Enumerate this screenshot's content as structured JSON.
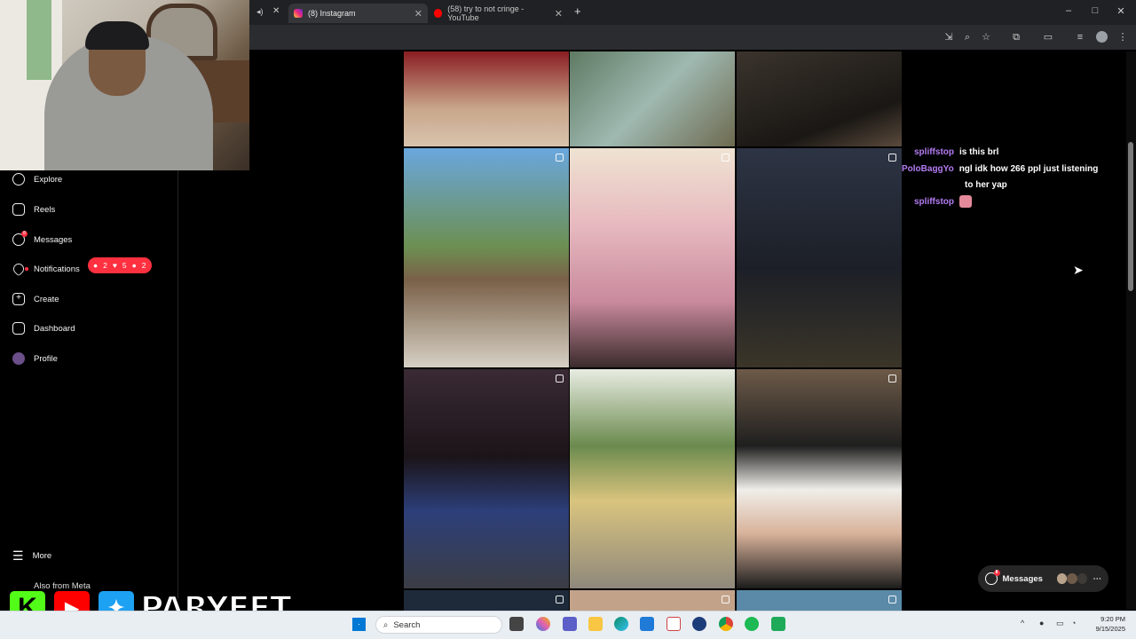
{
  "browser": {
    "tabs": [
      {
        "label": "(8) Instagram",
        "active": true,
        "favicon": "instagram-icon"
      },
      {
        "label": "(58) try to not cringe - YouTube",
        "active": false,
        "favicon": "youtube-icon"
      }
    ],
    "new_tab": "+",
    "window_controls": [
      "–",
      "□",
      "✕"
    ]
  },
  "sidebar": {
    "items": [
      {
        "label": "Explore",
        "icon": "compass-icon"
      },
      {
        "label": "Reels",
        "icon": "reels-icon"
      },
      {
        "label": "Messages",
        "icon": "messenger-icon",
        "badge": "8"
      },
      {
        "label": "Notifications",
        "icon": "heart-icon"
      },
      {
        "label": "Create",
        "icon": "plus-square-icon"
      },
      {
        "label": "Dashboard",
        "icon": "chart-icon"
      },
      {
        "label": "Profile",
        "icon": "avatar-icon"
      }
    ],
    "notifications_pill": {
      "comments": "2",
      "likes": "5",
      "follows": "2"
    },
    "more": "More",
    "also_from_meta": "Also from Meta"
  },
  "chat": [
    {
      "user": "spliffstop",
      "message": "is this brl"
    },
    {
      "user": "PoloBaggYo",
      "message": "ngl idk how 266 ppl just listening"
    },
    {
      "user": "",
      "message": "to her yap"
    },
    {
      "user": "spliffstop",
      "message": ""
    }
  ],
  "messages_button": {
    "label": "Messages",
    "badge": "8"
  },
  "watermark": {
    "text": "PARYEET"
  },
  "taskbar": {
    "search_placeholder": "Search",
    "time": "9:20 PM",
    "date": "9/15/2025"
  },
  "colors": {
    "accent_red": "#ff3040",
    "chat_username": "#b37cf2",
    "background": "#000000"
  }
}
